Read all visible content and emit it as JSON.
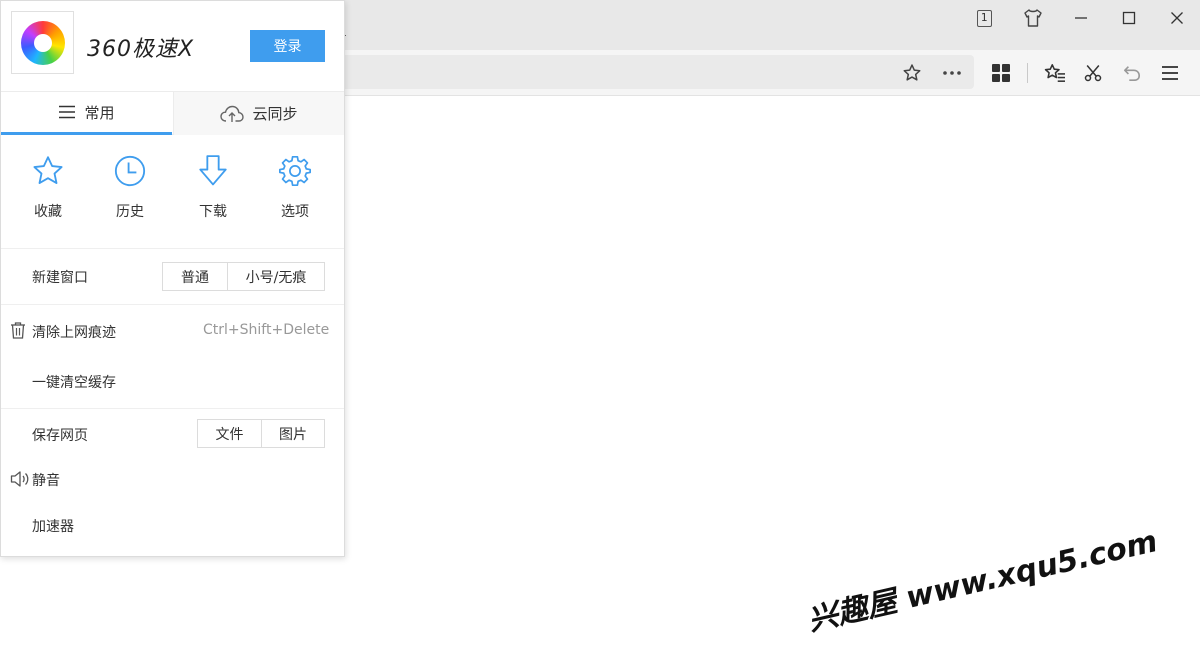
{
  "tabs": {
    "active_tab_fragment": "-"
  },
  "window": {
    "tab_count": "1",
    "icons": [
      "tab-count-icon",
      "skin-icon",
      "minimize-icon",
      "maximize-icon",
      "close-icon"
    ]
  },
  "toolbar": {
    "icons": [
      "bookmark-star-icon",
      "more-icon",
      "apps-grid-icon",
      "favorites-list-icon",
      "scissors-icon",
      "undo-icon",
      "menu-icon"
    ]
  },
  "menu": {
    "brand": "360极速X",
    "login_label": "登录",
    "tabs": [
      {
        "label": "常用",
        "icon": "list-icon",
        "active": true
      },
      {
        "label": "云同步",
        "icon": "cloud-upload-icon",
        "active": false
      }
    ],
    "quick_actions": [
      {
        "label": "收藏",
        "icon": "star-icon"
      },
      {
        "label": "历史",
        "icon": "clock-icon"
      },
      {
        "label": "下载",
        "icon": "download-arrow-icon"
      },
      {
        "label": "选项",
        "icon": "gear-icon"
      }
    ],
    "new_window": {
      "label": "新建窗口",
      "options": [
        "普通",
        "小号/无痕"
      ]
    },
    "clear_history": {
      "label": "清除上网痕迹",
      "shortcut": "Ctrl+Shift+Delete",
      "icon": "trash-icon"
    },
    "clear_cache": {
      "label": "一键清空缓存"
    },
    "save_page": {
      "label": "保存网页",
      "options": [
        "文件",
        "图片"
      ]
    },
    "mute": {
      "label": "静音",
      "icon": "speaker-icon"
    },
    "accelerator": {
      "label": "加速器"
    }
  },
  "watermark": "兴趣屋 www.xqu5.com",
  "colors": {
    "accent": "#3f9dee",
    "titlebar": "#e8e8e8",
    "toolbar": "#f5f5f5"
  }
}
